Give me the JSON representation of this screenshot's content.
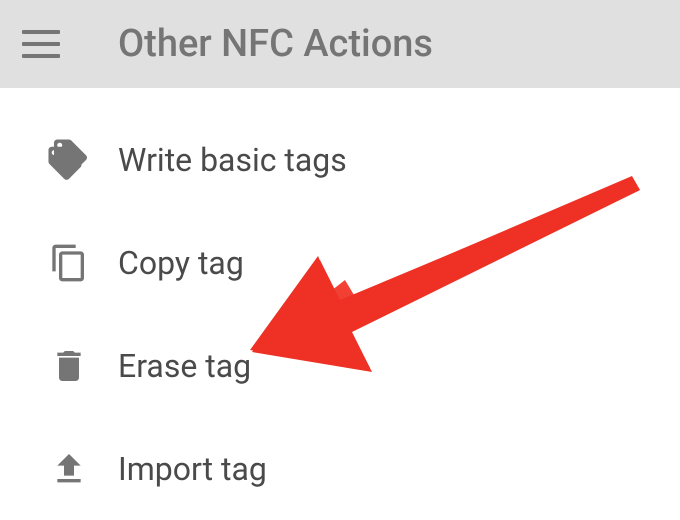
{
  "header": {
    "title": "Other NFC Actions"
  },
  "menu": {
    "items": [
      {
        "label": "Write basic tags",
        "icon": "tags-icon"
      },
      {
        "label": "Copy tag",
        "icon": "copy-icon"
      },
      {
        "label": "Erase tag",
        "icon": "trash-icon"
      },
      {
        "label": "Import tag",
        "icon": "upload-icon"
      }
    ]
  },
  "annotation": {
    "arrow_target": "erase-tag",
    "arrow_color": "#ee3124"
  }
}
